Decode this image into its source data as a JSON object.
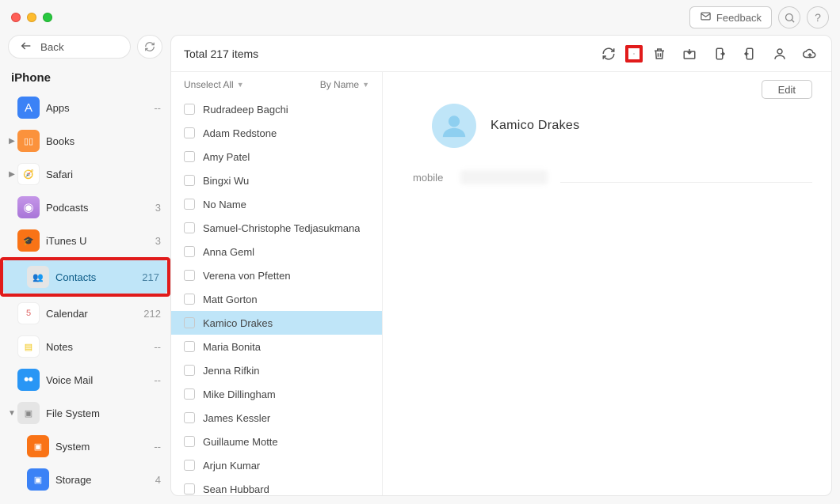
{
  "window": {
    "feedback_label": "Feedback"
  },
  "sidebar": {
    "back_label": "Back",
    "device_title": "iPhone",
    "items": [
      {
        "label": "Apps",
        "count": "--",
        "disclosure": false,
        "icon": "apps-icon",
        "icon_char": "A",
        "icon_class": "bg-blue"
      },
      {
        "label": "Books",
        "count": "",
        "disclosure": true,
        "icon": "books-icon",
        "icon_char": "▯▯",
        "icon_class": "bg-orange mini"
      },
      {
        "label": "Safari",
        "count": "",
        "disclosure": true,
        "icon": "safari-icon",
        "icon_char": "🧭",
        "icon_class": "bg-safari mini"
      },
      {
        "label": "Podcasts",
        "count": "3",
        "disclosure": false,
        "icon": "podcasts-icon",
        "icon_char": "◉",
        "icon_class": "bg-lav"
      },
      {
        "label": "iTunes U",
        "count": "3",
        "disclosure": false,
        "icon": "itunesu-icon",
        "icon_char": "🎓",
        "icon_class": "bg-or2 mini"
      },
      {
        "label": "Contacts",
        "count": "217",
        "disclosure": false,
        "icon": "contacts-icon",
        "icon_char": "👥",
        "icon_class": "bg-gray mini",
        "selected": true,
        "highlighted": true
      },
      {
        "label": "Calendar",
        "count": "212",
        "disclosure": false,
        "icon": "calendar-icon",
        "icon_char": "5",
        "icon_class": "bg-cal mini"
      },
      {
        "label": "Notes",
        "count": "--",
        "disclosure": false,
        "icon": "notes-icon",
        "icon_char": "▤",
        "icon_class": "bg-yel mini"
      },
      {
        "label": "Voice Mail",
        "count": "--",
        "disclosure": false,
        "icon": "voicemail-icon",
        "icon_char": "⏺⏺",
        "icon_class": "bg-vm mini"
      },
      {
        "label": "File System",
        "count": "",
        "disclosure": true,
        "disclosure_open": true,
        "icon": "filesystem-icon",
        "icon_char": "▣",
        "icon_class": "bg-gray mini"
      },
      {
        "label": "System",
        "count": "--",
        "disclosure": false,
        "icon": "system-icon",
        "icon_char": "▣",
        "icon_class": "bg-sys mini",
        "indent": true
      },
      {
        "label": "Storage",
        "count": "4",
        "disclosure": false,
        "icon": "storage-icon",
        "icon_char": "▣",
        "icon_class": "bg-st mini",
        "indent": true
      }
    ]
  },
  "toolbar": {
    "total_label": "Total 217 items",
    "buttons": [
      {
        "name": "refresh-icon"
      },
      {
        "name": "add-icon",
        "highlighted": true
      },
      {
        "name": "delete-icon"
      },
      {
        "name": "to-device-icon"
      },
      {
        "name": "export-icon"
      },
      {
        "name": "import-icon"
      },
      {
        "name": "merge-icon"
      },
      {
        "name": "cloud-icon"
      }
    ]
  },
  "list": {
    "header_left": "Unselect All",
    "header_right": "By Name",
    "rows": [
      {
        "label": "Rudradeep Bagchi"
      },
      {
        "label": "Adam Redstone"
      },
      {
        "label": "Amy Patel"
      },
      {
        "label": "Bingxi Wu"
      },
      {
        "label": "No Name"
      },
      {
        "label": "Samuel-Christophe Tedjasukmana"
      },
      {
        "label": "Anna Geml"
      },
      {
        "label": "Verena von Pfetten"
      },
      {
        "label": "Matt Gorton"
      },
      {
        "label": "Kamico Drakes",
        "selected": true
      },
      {
        "label": "Maria Bonita"
      },
      {
        "label": "Jenna Rifkin"
      },
      {
        "label": "Mike Dillingham"
      },
      {
        "label": "James Kessler"
      },
      {
        "label": "Guillaume Motte"
      },
      {
        "label": "Arjun Kumar"
      },
      {
        "label": "Sean Hubbard"
      }
    ]
  },
  "detail": {
    "edit_label": "Edit",
    "name": "Kamico  Drakes",
    "fields": [
      {
        "label": "mobile"
      }
    ]
  }
}
